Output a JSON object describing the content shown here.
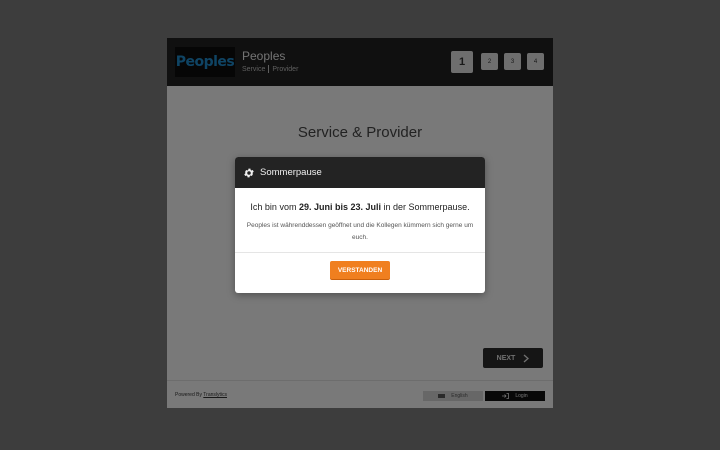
{
  "header": {
    "logo_text": "Peoples",
    "title": "Peoples",
    "sub_items": [
      "Service",
      "Provider"
    ],
    "steps": [
      "1",
      "2",
      "3",
      "4"
    ]
  },
  "main": {
    "heading": "Service & Provider",
    "next_label": "NEXT"
  },
  "footer": {
    "powered_prefix": "Powered By",
    "powered_link": "Translytics",
    "language_label": "English",
    "login_label": "Login"
  },
  "modal": {
    "title": "Sommerpause",
    "line1_prefix": "Ich bin vom",
    "line1_bold": "29. Juni bis 23. Juli",
    "line1_suffix": "in der Sommerpause.",
    "line2": "Peoples ist währenddessen geöffnet und die Kollegen kümmern sich gerne um euch.",
    "button_label": "VERSTANDEN"
  },
  "colors": {
    "accent": "#f07f1f",
    "header_bg": "#202020",
    "logo_text": "#1f88c9"
  }
}
